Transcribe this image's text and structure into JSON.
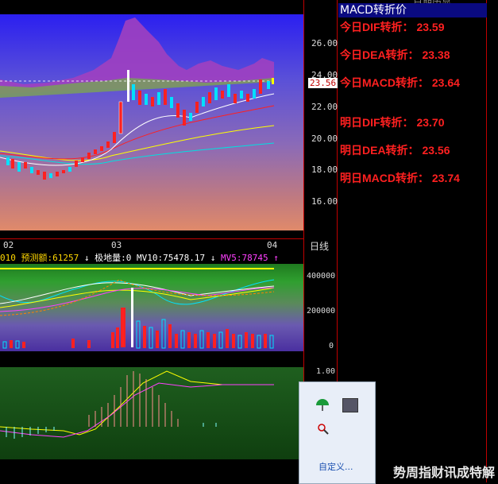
{
  "price_axis": [
    "26.00",
    "24.00",
    "22.00",
    "20.00",
    "18.00",
    "16.00"
  ],
  "price_marker": "23.56",
  "date_axis": [
    "02",
    "03",
    "04"
  ],
  "date_axis_label": "日线",
  "volume_header": {
    "prefix": "010",
    "forecast": "预测额:61257",
    "limit": "极地量:0",
    "mv10": "MV10:75478.17",
    "mv5": "MV5:78745",
    "arrow_down": "↓",
    "arrow_up": "↑"
  },
  "volume_axis": [
    "400000",
    "200000",
    "0"
  ],
  "indicator_axis": [
    "1.00"
  ],
  "top_right_text": "日期历显",
  "panel": {
    "title": "MACD转折价",
    "rows": [
      {
        "label": "今日DIF转折：",
        "value": "23.59"
      },
      {
        "label": "今日DEA转折：",
        "value": "23.38"
      },
      {
        "label": "今日MACD转折：",
        "value": "23.64"
      },
      {
        "label": "明日DIF转折：",
        "value": "23.70"
      },
      {
        "label": "明日DEA转折：",
        "value": "23.56"
      },
      {
        "label": "明日MACD转折：",
        "value": "23.74"
      }
    ]
  },
  "popup": {
    "custom_label": "自定义..."
  },
  "watermark": "势周指财讯成特解",
  "colors": {
    "dif": "#ff2020",
    "panel_title_bg": "#0a0a80",
    "axis_red": "#c00000"
  }
}
